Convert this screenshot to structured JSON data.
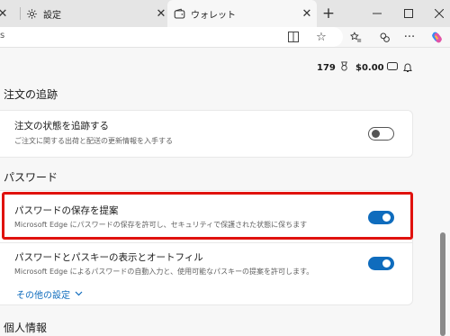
{
  "tabs": [
    {
      "label": "設定",
      "icon": "gear-icon",
      "active": false
    },
    {
      "label": "ウォレット",
      "icon": "wallet-icon",
      "active": true
    }
  ],
  "window_controls": [
    "minimize-icon",
    "maximize-icon",
    "close-icon"
  ],
  "address_bar": {
    "text": "s"
  },
  "wallet": {
    "points": "179",
    "balance": "$0.00"
  },
  "sections": {
    "order_tracking": {
      "title": "注文の追跡",
      "item_title": "注文の状態を追跡する",
      "item_desc": "ご注文に関する出荷と配送の更新情報を入手する",
      "toggle_state": "off"
    },
    "passwords": {
      "title": "パスワード",
      "item1_title": "パスワードの保存を提案",
      "item1_desc": "Microsoft Edge にパスワードの保存を許可し、セキュリティで保護された状態に保ちます",
      "item1_toggle": "on",
      "item2_title": "パスワードとパスキーの表示とオートフィル",
      "item2_desc": "Microsoft Edge によるパスワードの自動入力と、使用可能なパスキーの提案を許可します。",
      "item2_toggle": "on",
      "more_settings": "その他の設定"
    },
    "personal_info": {
      "title": "個人情報"
    }
  },
  "colors": {
    "accent": "#0f6cbd",
    "highlight": "#e0120e"
  }
}
